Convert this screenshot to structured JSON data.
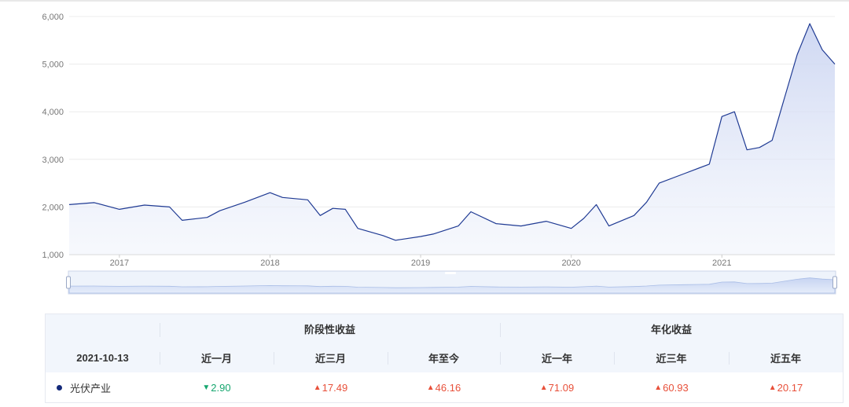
{
  "chart_data": {
    "type": "area",
    "y_ticks": [
      "1,000",
      "2,000",
      "3,000",
      "4,000",
      "5,000",
      "6,000"
    ],
    "x_ticks": [
      "2017",
      "2018",
      "2019",
      "2020",
      "2021"
    ],
    "ylim": [
      1000,
      6000
    ],
    "xlim": [
      "2016-09",
      "2021-10"
    ],
    "grid": true,
    "line_color": "#1f3a93",
    "area_color": "#dbe2f6",
    "series": [
      {
        "x": [
          "2016-09",
          "2016-11",
          "2017-01",
          "2017-03",
          "2017-05",
          "2017-06",
          "2017-08",
          "2017-09",
          "2017-11",
          "2018-01",
          "2018-02",
          "2018-04",
          "2018-05",
          "2018-06",
          "2018-07",
          "2018-08",
          "2018-10",
          "2018-11",
          "2019-01",
          "2019-02",
          "2019-04",
          "2019-05",
          "2019-07",
          "2019-09",
          "2019-11",
          "2020-01",
          "2020-02",
          "2020-03",
          "2020-04",
          "2020-06",
          "2020-07",
          "2020-08",
          "2020-10",
          "2020-12",
          "2021-01",
          "2021-02",
          "2021-03",
          "2021-04",
          "2021-05",
          "2021-06",
          "2021-07",
          "2021-08",
          "2021-09",
          "2021-10"
        ],
        "y": [
          2050,
          2090,
          1950,
          2040,
          2000,
          1720,
          1780,
          1920,
          2100,
          2300,
          2200,
          2150,
          1820,
          1970,
          1950,
          1550,
          1400,
          1300,
          1380,
          1430,
          1600,
          1900,
          1650,
          1600,
          1700,
          1550,
          1760,
          2050,
          1600,
          1820,
          2100,
          2500,
          2700,
          2900,
          3900,
          4000,
          3200,
          3250,
          3400,
          4300,
          5200,
          5850,
          5300,
          5000
        ]
      }
    ],
    "navigator": {
      "handle_left": "2016-09",
      "handle_right": "2021-10"
    }
  },
  "table": {
    "date": "2021-10-13",
    "group_stage": "阶段性收益",
    "group_annual": "年化收益",
    "col_1m": "近一月",
    "col_3m": "近三月",
    "col_ytd": "年至今",
    "col_1y": "近一年",
    "col_3y": "近三年",
    "col_5y": "近五年",
    "row": {
      "name": "光伏产业",
      "v_1m": "2.90",
      "v_3m": "17.49",
      "v_ytd": "46.16",
      "v_1y": "71.09",
      "v_3y": "60.93",
      "v_5y": "20.17"
    },
    "arrow_up": "▲",
    "arrow_down": "▼",
    "colors": {
      "up": "#e8503a",
      "down": "#15a66e",
      "series_dot": "#142a7a"
    }
  }
}
